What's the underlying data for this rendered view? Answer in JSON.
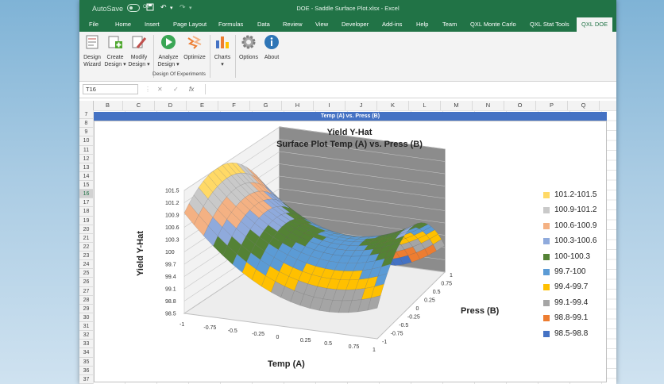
{
  "titlebar": {
    "autosave": "AutoSave",
    "autosave_state": "Off",
    "window_title": "DOE - Saddle Surface Plot.xlsx  -  Excel"
  },
  "ribbon_tabs": [
    "File",
    "Home",
    "Insert",
    "Page Layout",
    "Formulas",
    "Data",
    "Review",
    "View",
    "Developer",
    "Add-ins",
    "Help",
    "Team",
    "QXL Monte Carlo",
    "QXL Stat Tools",
    "QXL DOE"
  ],
  "ribbon": {
    "buttons": [
      {
        "line1": "Design",
        "line2": "Wizard"
      },
      {
        "line1": "Create",
        "line2": "Design ▾"
      },
      {
        "line1": "Modify",
        "line2": "Design ▾"
      },
      {
        "line1": "Analyze",
        "line2": "Design ▾"
      },
      {
        "line1": "Optimize",
        "line2": ""
      },
      {
        "line1": "Charts",
        "line2": "▾"
      },
      {
        "line1": "Options",
        "line2": ""
      },
      {
        "line1": "About",
        "line2": ""
      }
    ],
    "group_label": "Design Of Experiments"
  },
  "formula_bar": {
    "name_box": "T16",
    "cancel": "✕",
    "enter": "✓",
    "fx": "fx"
  },
  "columns": [
    "B",
    "C",
    "D",
    "E",
    "F",
    "G",
    "H",
    "I",
    "J",
    "K",
    "L",
    "M",
    "N",
    "O",
    "P",
    "Q"
  ],
  "rows": [
    "7",
    "8",
    "9",
    "10",
    "11",
    "12",
    "13",
    "14",
    "15",
    "16",
    "17",
    "18",
    "19",
    "20",
    "21",
    "22",
    "23",
    "24",
    "25",
    "26",
    "27",
    "28",
    "29",
    "30",
    "31",
    "32",
    "33",
    "34",
    "35",
    "36",
    "37"
  ],
  "selected_row": "16",
  "banner": "Temp (A) vs. Press (B)",
  "chart_data": {
    "type": "surface",
    "title": "Yield Y-Hat",
    "subtitle": "Surface Plot Temp (A) vs. Press (B)",
    "xlabel": "Temp (A)",
    "ylabel": "Press (B)",
    "zlabel": "Yield Y-Hat",
    "x_ticks": [
      "-1",
      "-0.75",
      "-0.5",
      "-0.25",
      "0",
      "0.25",
      "0.5",
      "0.75",
      "1"
    ],
    "y_ticks": [
      "-1",
      "-0.75",
      "-0.5",
      "-0.25",
      "0",
      "0.25",
      "0.5",
      "0.75",
      "1"
    ],
    "z_ticks": [
      "98.5",
      "98.8",
      "99.1",
      "99.4",
      "99.7",
      "100",
      "100.3",
      "100.6",
      "100.9",
      "101.2",
      "101.5"
    ],
    "zlim": [
      98.5,
      101.5
    ],
    "legend": [
      {
        "label": "101.2-101.5",
        "color": "#ffd966"
      },
      {
        "label": "100.9-101.2",
        "color": "#c9c9c9"
      },
      {
        "label": "100.6-100.9",
        "color": "#f4b183"
      },
      {
        "label": "100.3-100.6",
        "color": "#8faadc"
      },
      {
        "label": "100-100.3",
        "color": "#548235"
      },
      {
        "label": "99.7-100",
        "color": "#5b9bd5"
      },
      {
        "label": "99.4-99.7",
        "color": "#ffc000"
      },
      {
        "label": "99.1-99.4",
        "color": "#a5a5a5"
      },
      {
        "label": "98.8-99.1",
        "color": "#ed7d31"
      },
      {
        "label": "98.5-98.8",
        "color": "#4472c4"
      }
    ]
  }
}
